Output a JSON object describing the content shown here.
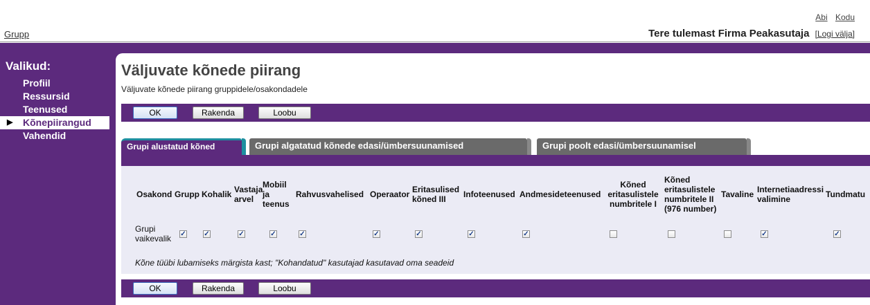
{
  "top_links": {
    "help": "Abi",
    "home": "Kodu"
  },
  "header": {
    "group_link": "Grupp",
    "welcome": "Tere tulemast Firma Peakasutaja",
    "logout": "[Logi välja]"
  },
  "sidebar": {
    "title": "Valikud:",
    "items": [
      {
        "label": "Profiil"
      },
      {
        "label": "Ressursid"
      },
      {
        "label": "Teenused"
      },
      {
        "label": "Kõnepiirangud",
        "active": true
      },
      {
        "label": "Vahendid"
      }
    ]
  },
  "page": {
    "title": "Väljuvate kõnede piirang",
    "subtitle": "Väljuvate kõnede piirang gruppidele/osakondadele"
  },
  "buttons": {
    "ok": "OK",
    "apply": "Rakenda",
    "cancel": "Loobu"
  },
  "tabs": [
    {
      "label": "Grupi alustatud kõned",
      "active": true
    },
    {
      "label": "Grupi algatatud kõnede edasi/ümbersuunamised",
      "active": false
    },
    {
      "label": "Grupi poolt edasi/ümbersuunamisel",
      "active": false
    }
  ],
  "table": {
    "headers": [
      "Osakond",
      "Grupp",
      "Kohalik",
      "Vastaja arvel",
      "Mobiil ja teenus",
      "Rahvusvahelised",
      "Operaator",
      "Eritasulised kõned III",
      "Infoteenused",
      "Andmesideteenused",
      "Kõned eritasulistele numbritele I",
      "Kõned eritasulistele numbritele II (976 number)",
      "Tavaline",
      "Internetiaadressi valimine",
      "Tundmatu"
    ],
    "row": {
      "label": "Grupi vaikevalik",
      "checks": [
        true,
        true,
        true,
        true,
        true,
        true,
        true,
        true,
        true,
        false,
        false,
        false,
        true,
        true
      ]
    },
    "hint": "Kõne tüübi lubamiseks märgista kast; \"Kohandatud\" kasutajad kasutavad oma seadeid"
  },
  "colors": {
    "brand_purple": "#5c2a7d",
    "tab_accent": "#1e8fa0",
    "table_bg": "#ebebf5"
  }
}
